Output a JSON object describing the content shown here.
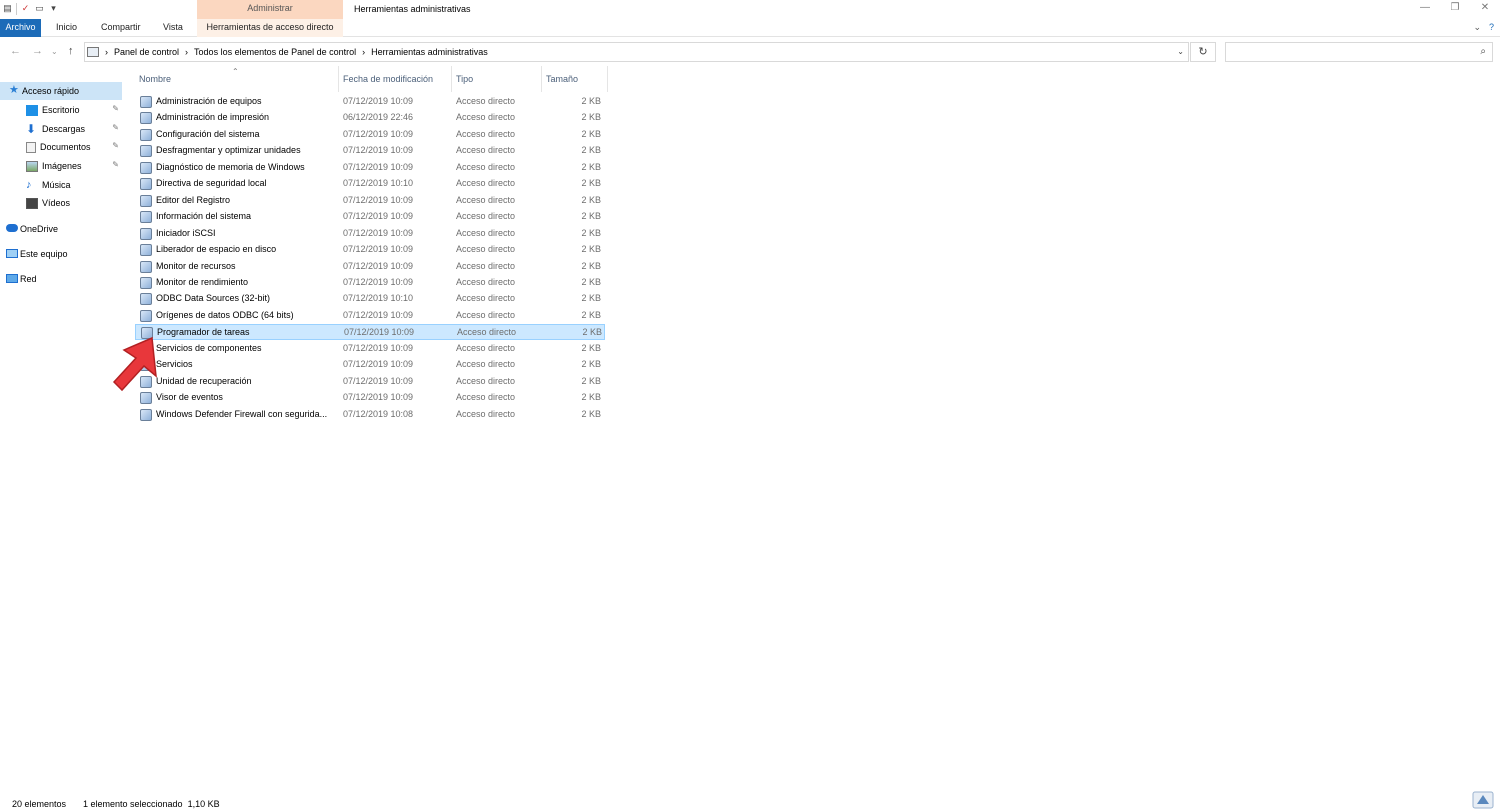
{
  "window": {
    "title": "Herramientas administrativas",
    "context_group": "Administrar",
    "controls": {
      "minimize": "—",
      "restore": "❐",
      "close": "✕"
    }
  },
  "ribbon": {
    "tabs": [
      "Archivo",
      "Inicio",
      "Compartir",
      "Vista"
    ],
    "context_tab": "Herramientas de acceso directo",
    "collapse_icon": "chevron-down-icon",
    "help_icon": "question-icon"
  },
  "address": {
    "crumbs": [
      "Panel de control",
      "Todos los elementos de Panel de control",
      "Herramientas administrativas"
    ],
    "search_placeholder": ""
  },
  "nav": {
    "items": [
      {
        "label": "Acceso rápido",
        "icon": "star-icon",
        "selected": true,
        "pinned": false
      },
      {
        "label": "Escritorio",
        "icon": "desktop-icon",
        "selected": false,
        "pinned": true
      },
      {
        "label": "Descargas",
        "icon": "download-icon",
        "selected": false,
        "pinned": true
      },
      {
        "label": "Documentos",
        "icon": "document-icon",
        "selected": false,
        "pinned": true
      },
      {
        "label": "Imágenes",
        "icon": "image-icon",
        "selected": false,
        "pinned": true
      },
      {
        "label": "Música",
        "icon": "music-icon",
        "selected": false,
        "pinned": false
      },
      {
        "label": "Vídeos",
        "icon": "video-icon",
        "selected": false,
        "pinned": false
      },
      {
        "label": "OneDrive",
        "icon": "cloud-icon",
        "selected": false,
        "pinned": false
      },
      {
        "label": "Este equipo",
        "icon": "computer-icon",
        "selected": false,
        "pinned": false
      },
      {
        "label": "Red",
        "icon": "network-icon",
        "selected": false,
        "pinned": false
      }
    ]
  },
  "columns": {
    "name": "Nombre",
    "date": "Fecha de modificación",
    "type": "Tipo",
    "size": "Tamaño"
  },
  "files": [
    {
      "name": "Administración de equipos",
      "date": "07/12/2019 10:09",
      "type": "Acceso directo",
      "size": "2 KB"
    },
    {
      "name": "Administración de impresión",
      "date": "06/12/2019 22:46",
      "type": "Acceso directo",
      "size": "2 KB"
    },
    {
      "name": "Configuración del sistema",
      "date": "07/12/2019 10:09",
      "type": "Acceso directo",
      "size": "2 KB"
    },
    {
      "name": "Desfragmentar y optimizar unidades",
      "date": "07/12/2019 10:09",
      "type": "Acceso directo",
      "size": "2 KB"
    },
    {
      "name": "Diagnóstico de memoria de Windows",
      "date": "07/12/2019 10:09",
      "type": "Acceso directo",
      "size": "2 KB"
    },
    {
      "name": "Directiva de seguridad local",
      "date": "07/12/2019 10:10",
      "type": "Acceso directo",
      "size": "2 KB"
    },
    {
      "name": "Editor del Registro",
      "date": "07/12/2019 10:09",
      "type": "Acceso directo",
      "size": "2 KB"
    },
    {
      "name": "Información del sistema",
      "date": "07/12/2019 10:09",
      "type": "Acceso directo",
      "size": "2 KB"
    },
    {
      "name": "Iniciador iSCSI",
      "date": "07/12/2019 10:09",
      "type": "Acceso directo",
      "size": "2 KB"
    },
    {
      "name": "Liberador de espacio en disco",
      "date": "07/12/2019 10:09",
      "type": "Acceso directo",
      "size": "2 KB"
    },
    {
      "name": "Monitor de recursos",
      "date": "07/12/2019 10:09",
      "type": "Acceso directo",
      "size": "2 KB"
    },
    {
      "name": "Monitor de rendimiento",
      "date": "07/12/2019 10:09",
      "type": "Acceso directo",
      "size": "2 KB"
    },
    {
      "name": "ODBC Data Sources (32-bit)",
      "date": "07/12/2019 10:10",
      "type": "Acceso directo",
      "size": "2 KB"
    },
    {
      "name": "Orígenes de datos ODBC (64 bits)",
      "date": "07/12/2019 10:09",
      "type": "Acceso directo",
      "size": "2 KB"
    },
    {
      "name": "Programador de tareas",
      "date": "07/12/2019 10:09",
      "type": "Acceso directo",
      "size": "2 KB",
      "selected": true
    },
    {
      "name": "Servicios de componentes",
      "date": "07/12/2019 10:09",
      "type": "Acceso directo",
      "size": "2 KB"
    },
    {
      "name": "Servicios",
      "date": "07/12/2019 10:09",
      "type": "Acceso directo",
      "size": "2 KB"
    },
    {
      "name": "Unidad de recuperación",
      "date": "07/12/2019 10:09",
      "type": "Acceso directo",
      "size": "2 KB"
    },
    {
      "name": "Visor de eventos",
      "date": "07/12/2019 10:09",
      "type": "Acceso directo",
      "size": "2 KB"
    },
    {
      "name": "Windows Defender Firewall con segurida...",
      "date": "07/12/2019 10:08",
      "type": "Acceso directo",
      "size": "2 KB"
    }
  ],
  "status": {
    "count": "20 elementos",
    "selection": "1 elemento seleccionado  1,10 KB"
  },
  "colors": {
    "file_tab": "#1c6bb8",
    "selected_row": "#cce8ff",
    "context_tab": "#fbd7c0",
    "arrow": "#e8373b"
  }
}
